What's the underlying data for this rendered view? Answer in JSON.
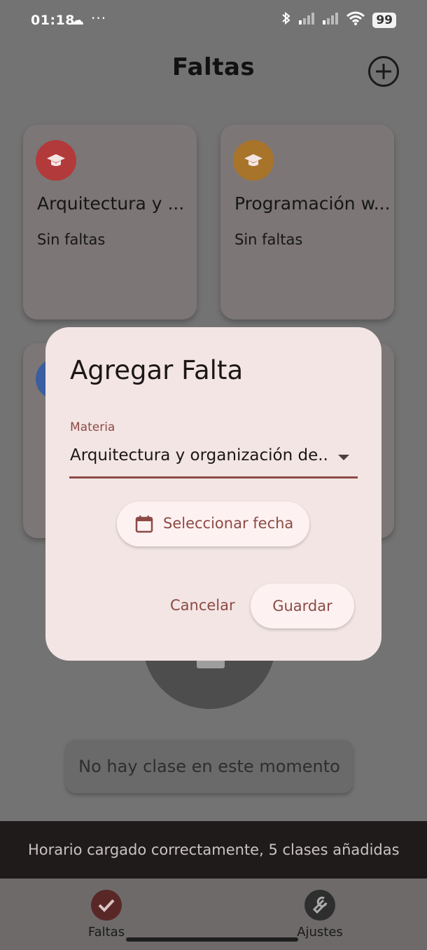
{
  "status_bar": {
    "time": "01:18",
    "dots": "···",
    "battery": "99"
  },
  "app_bar": {
    "title": "Faltas"
  },
  "cards": [
    {
      "title": "Arquitectura y ...",
      "subtitle": "Sin faltas",
      "color": "#b23a3a"
    },
    {
      "title": "Programación w...",
      "subtitle": "Sin faltas",
      "color": "#a8742a"
    }
  ],
  "colors": {
    "accent": "#8c4a45",
    "dialog_bg": "#f3e5e4",
    "nav_active": "#5a2727"
  },
  "dialog": {
    "title": "Agregar Falta",
    "field_label": "Materia",
    "selected_subject": "Arquitectura y organización de...",
    "date_button": "Seleccionar fecha",
    "cancel": "Cancelar",
    "save": "Guardar"
  },
  "no_class": "No hay clase en este momento",
  "snackbar": "Horario cargado correctamente, 5 clases añadidas",
  "bottom_nav": [
    {
      "label": "Faltas",
      "icon": "check-icon",
      "active": true
    },
    {
      "label": "Ajustes",
      "icon": "wrench-icon",
      "active": false
    }
  ]
}
